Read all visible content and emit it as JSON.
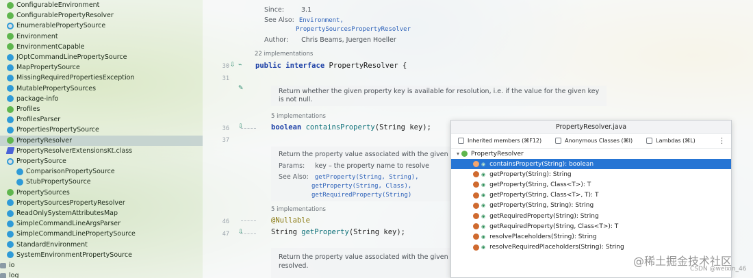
{
  "project_tree": {
    "items": [
      {
        "label": "ConfigurableEnvironment",
        "icon": "interface-icon",
        "top": 0
      },
      {
        "label": "ConfigurablePropertyResolver",
        "icon": "interface-icon"
      },
      {
        "label": "EnumerablePropertySource",
        "icon": "abstract-class-icon"
      },
      {
        "label": "Environment",
        "icon": "interface-icon"
      },
      {
        "label": "EnvironmentCapable",
        "icon": "interface-icon"
      },
      {
        "label": "JOptCommandLinePropertySource",
        "icon": "class-icon"
      },
      {
        "label": "MapPropertySource",
        "icon": "class-icon"
      },
      {
        "label": "MissingRequiredPropertiesException",
        "icon": "class-icon"
      },
      {
        "label": "MutablePropertySources",
        "icon": "class-icon"
      },
      {
        "label": "package-info",
        "icon": "class-icon"
      },
      {
        "label": "Profiles",
        "icon": "interface-icon"
      },
      {
        "label": "ProfilesParser",
        "icon": "class-icon"
      },
      {
        "label": "PropertiesPropertySource",
        "icon": "class-icon"
      },
      {
        "label": "PropertyResolver",
        "icon": "interface-icon",
        "selected": true
      },
      {
        "label": "PropertyResolverExtensionsKt.class",
        "icon": "kotlin-class-icon"
      },
      {
        "label": "PropertySource",
        "icon": "abstract-class-icon",
        "expanded": true
      },
      {
        "label": "ComparisonPropertySource",
        "icon": "class-icon",
        "indent": 1
      },
      {
        "label": "StubPropertySource",
        "icon": "class-icon",
        "indent": 1
      },
      {
        "label": "PropertySources",
        "icon": "interface-icon"
      },
      {
        "label": "PropertySourcesPropertyResolver",
        "icon": "class-icon"
      },
      {
        "label": "ReadOnlySystemAttributesMap",
        "icon": "class-icon"
      },
      {
        "label": "SimpleCommandLineArgsParser",
        "icon": "class-icon"
      },
      {
        "label": "SimpleCommandLinePropertySource",
        "icon": "class-icon"
      },
      {
        "label": "StandardEnvironment",
        "icon": "class-icon"
      },
      {
        "label": "SystemEnvironmentPropertySource",
        "icon": "class-icon"
      },
      {
        "label": "io",
        "icon": "package-icon"
      },
      {
        "label": "log",
        "icon": "package-icon"
      }
    ]
  },
  "editor": {
    "top_doc": {
      "since_label": "Since:",
      "since_value": "3.1",
      "see_also_label": "See Also:",
      "see_also_1": "Environment,",
      "see_also_2": "PropertySourcesPropertyResolver",
      "author_label": "Author:",
      "author_value": "Chris Beams, Juergen Hoeller"
    },
    "impl_hint_1": "22 implementations",
    "line_30": "30",
    "line_31": "31",
    "line_36": "36",
    "line_37": "37",
    "line_46": "46",
    "line_47": "47",
    "code_interface_kw": "public interface",
    "code_interface_name": "PropertyResolver {",
    "doc_contains": "Return whether the given property key is available for resolution, i.e. if the value for the given key is not null.",
    "impl_hint_2": "5 implementations",
    "code_contains_type": "boolean",
    "code_contains_name": "containsProperty",
    "code_contains_args": "(String key);",
    "doc_get": "Return the property value associated with the given key,",
    "params_label": "Params:",
    "params_value": "key – the property name to resolve",
    "see_also_label": "See Also:",
    "see_get_1": "getProperty(String, String),",
    "see_get_2": "getProperty(String, Class),",
    "see_get_3": "getRequiredProperty(String)",
    "impl_hint_3": "5 implementations",
    "annotation": "@Nullable",
    "code_get_type": "String",
    "code_get_name": "getProperty",
    "code_get_args": "(String key);",
    "doc_bottom": "Return the property value associated with the given ke",
    "doc_bottom_2": "resolved."
  },
  "structure_popup": {
    "title": "PropertyResolver.java",
    "filters": [
      {
        "label": "Inherited members (⌘F12)"
      },
      {
        "label": "Anonymous Classes (⌘I)"
      },
      {
        "label": "Lambdas (⌘L)"
      }
    ],
    "root": "PropertyResolver",
    "members": [
      {
        "label": "containsProperty(String): boolean",
        "selected": true
      },
      {
        "label": "getProperty(String): String"
      },
      {
        "label": "getProperty(String, Class<T>): T"
      },
      {
        "label": "getProperty(String, Class<T>, T): T"
      },
      {
        "label": "getProperty(String, String): String"
      },
      {
        "label": "getRequiredProperty(String): String"
      },
      {
        "label": "getRequiredProperty(String, Class<T>): T"
      },
      {
        "label": "resolvePlaceholders(String): String"
      },
      {
        "label": "resolveRequiredPlaceholders(String): String"
      }
    ]
  },
  "watermark": {
    "text": "@稀土掘金技术社区",
    "sub": "CSDN @weixin_46"
  },
  "colors": {
    "selection": "#2675d4",
    "method_icon": "#cf6a2f",
    "interface_icon": "#5fb64e",
    "class_icon": "#2f9bd7"
  }
}
